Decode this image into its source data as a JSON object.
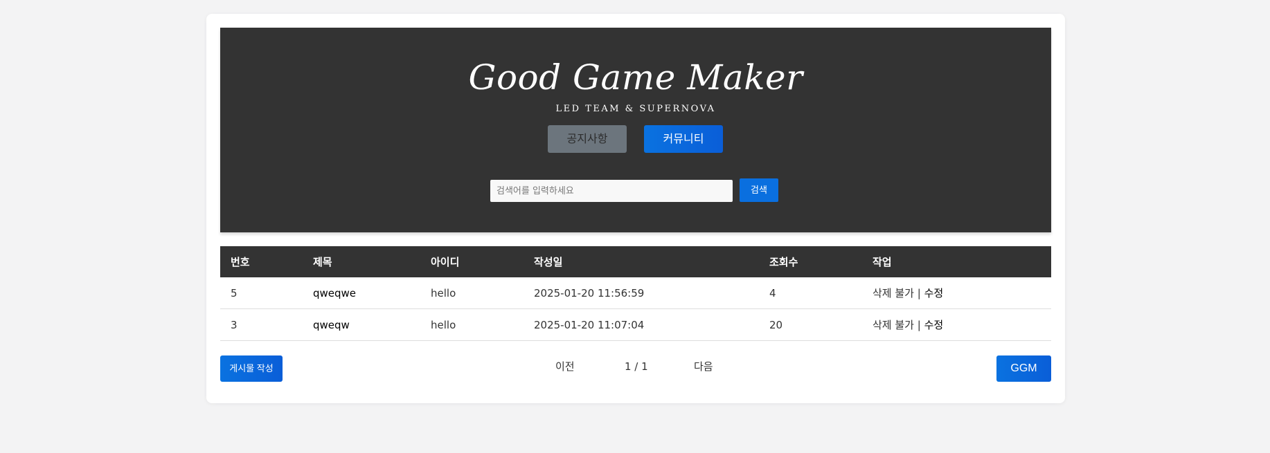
{
  "header": {
    "logo_title": "Good Game Maker",
    "logo_subtitle": "LED TEAM & SUPERNOVA",
    "nav": {
      "notice_label": "공지사항",
      "community_label": "커뮤니티"
    },
    "search": {
      "placeholder": "검색어를 입력하세요",
      "value": "",
      "button_label": "검색"
    }
  },
  "table": {
    "columns": [
      "번호",
      "제목",
      "아이디",
      "작성일",
      "조회수",
      "작업"
    ],
    "rows": [
      {
        "no": "5",
        "title": "qweqwe",
        "user_id": "hello",
        "date": "2025-01-20 11:56:59",
        "views": "4",
        "delete_label": "삭제 불가",
        "separator": " | ",
        "edit_label": "수정"
      },
      {
        "no": "3",
        "title": "qweqw",
        "user_id": "hello",
        "date": "2025-01-20 11:07:04",
        "views": "20",
        "delete_label": "삭제 불가",
        "separator": " | ",
        "edit_label": "수정"
      }
    ]
  },
  "footer": {
    "write_button_label": "게시물 작성",
    "pagination": {
      "prev_label": "이전",
      "page_info": "1 / 1",
      "next_label": "다음"
    },
    "ggm_button_label": "GGM"
  },
  "colors": {
    "background": "#f3f3f4",
    "header_bg": "#333333",
    "primary_blue": "#0a6fdf",
    "secondary_gray": "#6c757d"
  }
}
